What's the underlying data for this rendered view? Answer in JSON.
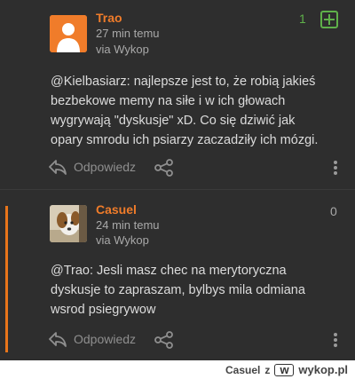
{
  "comments": [
    {
      "author": "Trao",
      "time": "27 min temu",
      "via": "via Wykop",
      "score": "1",
      "score_color": "#5fb14a",
      "avatar_icon": "default-user-avatar-icon",
      "text_lines": [
        "@Kielbasiarz: najlepsze jest to, że robią jakieś",
        "bezbekowe memy na siłe i w ich głowach",
        "wygrywają \"dyskusje\" xD. Co się dziwić jak",
        "opary smrodu ich psiarzy zaczadziły ich mózgi."
      ],
      "reply_label": "Odpowiedz",
      "vote_icon": "plus-square-icon"
    },
    {
      "author": "Casuel",
      "time": "24 min temu",
      "via": "via Wykop",
      "score": "0",
      "score_color": "#a9a9a9",
      "avatar_icon": "dog-photo-avatar",
      "text_lines": [
        "@Trao: Jesli masz chec na merytoryczna",
        "dyskusje to zapraszam, bylbys mila odmiana",
        "wsrod psiegrywow"
      ],
      "reply_label": "Odpowiedz"
    }
  ],
  "footer": {
    "author": "Casuel",
    "conjunction": "z",
    "logo_mark": "w",
    "site": "wykop.pl"
  },
  "colors": {
    "accent": "#f07c2a",
    "upvote": "#5fb14a",
    "background": "#2e2e2e"
  }
}
